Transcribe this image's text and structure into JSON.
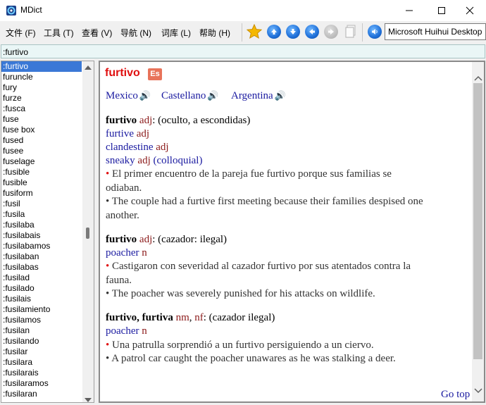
{
  "window": {
    "title": "MDict"
  },
  "menu": [
    "文件 (F)",
    "工具 (T)",
    "查看 (V)",
    "导航 (N)",
    "词库 (L)",
    "帮助 (H)"
  ],
  "toolbar": {
    "dictionary_selected": "Microsoft Huihui Desktop"
  },
  "search": {
    "value": ":furtivo"
  },
  "wordlist": [
    ":furtivo",
    "furuncle",
    "fury",
    "furze",
    ":fusca",
    "fuse",
    "fuse box",
    "fused",
    "fusee",
    "fuselage",
    ":fusible",
    "fusible",
    "fusiform",
    ":fusil",
    ":fusila",
    ":fusilaba",
    ":fusilabais",
    ":fusilabamos",
    ":fusilaban",
    ":fusilabas",
    ":fusilad",
    ":fusilado",
    ":fusilais",
    ":fusilamiento",
    ":fusilamos",
    ":fusilan",
    ":fusilando",
    ":fusilar",
    ":fusilara",
    ":fusilarais",
    ":fusilaramos",
    ":fusilaran"
  ],
  "entry": {
    "headword": "furtivo",
    "lang_badge": "Es",
    "pronunciations": [
      "Mexico",
      "Castellano",
      "Argentina"
    ],
    "senses": [
      {
        "head": "furtivo",
        "pos": "adj",
        "gloss": ": (oculto, a escondidas)",
        "translations": [
          {
            "word": "furtive",
            "pos": "adj"
          },
          {
            "word": "clandestine",
            "pos": "adj"
          },
          {
            "word": "sneaky",
            "pos": "adj",
            "note": "(colloquial)"
          }
        ],
        "example_es_1": "El primer encuentro de la pareja fue furtivo porque sus familias se",
        "example_es_2": "odiaban.",
        "example_en_1": "The couple had a furtive first meeting because their families despised one",
        "example_en_2": "another."
      },
      {
        "head": "furtivo",
        "pos": "adj",
        "gloss": ": (cazador: ilegal)",
        "translations": [
          {
            "word": "poacher",
            "pos": "n"
          }
        ],
        "example_es_1": "Castigaron con severidad al cazador furtivo por sus atentados contra la",
        "example_es_2": "fauna.",
        "example_en_1": "The poacher was severely punished for his attacks on wildlife."
      },
      {
        "head": "furtivo, furtiva",
        "pos": "nm",
        "pos2": "nf",
        "gloss": ": (cazador ilegal)",
        "translations": [
          {
            "word": "poacher",
            "pos": "n"
          }
        ],
        "example_es_1": "Una patrulla sorprendió a un furtivo persiguiendo a un ciervo.",
        "example_en_1": "A patrol car caught the poacher unawares as he was stalking a deer."
      }
    ],
    "go_top": "Go top"
  }
}
